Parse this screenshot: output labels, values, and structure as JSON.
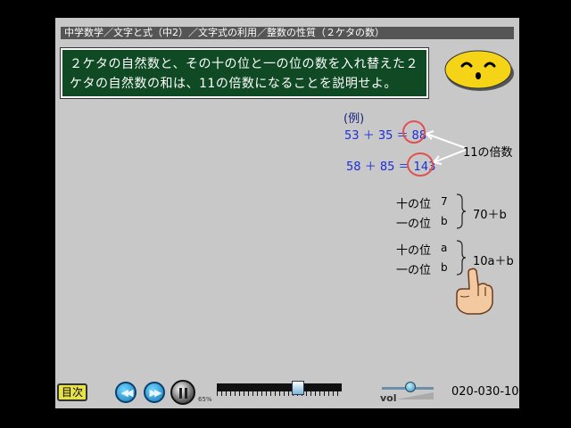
{
  "header": {
    "breadcrumb": "中学数学／文字と式（中2）／文字式の利用／整数の性質（２ケタの数）"
  },
  "question": {
    "line1": "２ケタの自然数と、その十の位と一の位の数を入れ替えた２",
    "line2": "ケタの自然数の和は、11の倍数になることを説明せよ。"
  },
  "example": {
    "label": "(例)",
    "eq1": {
      "a": "53",
      "op": "＋",
      "b": "35",
      "eq": "＝",
      "result": "88"
    },
    "eq2": {
      "a": "58",
      "op": "＋",
      "b": "85",
      "eq": "＝",
      "result": "143"
    },
    "multiple_label": "11の倍数"
  },
  "place_values_1": {
    "tens_label": "十の位",
    "tens_value": "7",
    "ones_label": "一の位",
    "ones_value": "b",
    "expression": "70＋b"
  },
  "place_values_2": {
    "tens_label": "十の位",
    "tens_value": "a",
    "ones_label": "一の位",
    "ones_value": "b",
    "expression_a": "10",
    "expression_rest": "a＋b"
  },
  "controls": {
    "menu_label": "目次",
    "percent": "65%",
    "volume_label": "vol",
    "page_code": "020-030-10",
    "seek_progress": 0.65
  },
  "colors": {
    "accent_blue": "#1a2ed8",
    "circle_red": "#e05050",
    "question_bg": "#0f4a24"
  }
}
